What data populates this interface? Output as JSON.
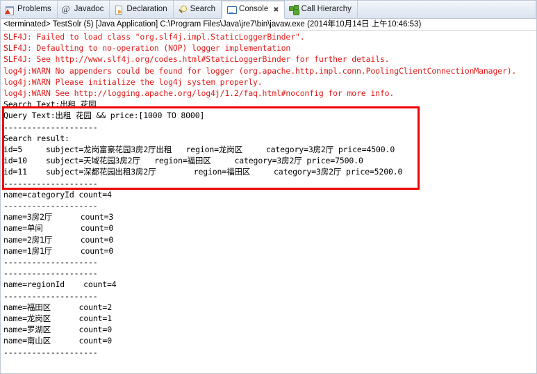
{
  "window": {
    "title": "Console"
  },
  "tabs": [
    {
      "label": "Problems",
      "icon": "problems-icon",
      "active": false,
      "closeable": false
    },
    {
      "label": "Javadoc",
      "icon": "javadoc-icon",
      "active": false,
      "closeable": false
    },
    {
      "label": "Declaration",
      "icon": "declaration-icon",
      "active": false,
      "closeable": false
    },
    {
      "label": "Search",
      "icon": "search-icon",
      "active": false,
      "closeable": false
    },
    {
      "label": "Console",
      "icon": "console-icon",
      "active": true,
      "closeable": true,
      "close_glyph": "✖"
    },
    {
      "label": "Call Hierarchy",
      "icon": "call-hierarchy-icon",
      "active": false,
      "closeable": false
    }
  ],
  "process": {
    "terminated_line": "<terminated> TestSolr (5) [Java Application] C:\\Program Files\\Java\\jre7\\bin\\javaw.exe (2014年10月14日 上午10:46:53)"
  },
  "console": {
    "error_lines": [
      "SLF4J: Failed to load class \"org.slf4j.impl.StaticLoggerBinder\".",
      "SLF4J: Defaulting to no-operation (NOP) logger implementation",
      "SLF4J: See http://www.slf4j.org/codes.html#StaticLoggerBinder for further details.",
      "log4j:WARN No appenders could be found for logger (org.apache.http.impl.conn.PoolingClientConnectionManager).",
      "log4j:WARN Please initialize the log4j system properly.",
      "log4j:WARN See http://logging.apache.org/log4j/1.2/faq.html#noconfig for more info."
    ],
    "output_lines": [
      "Search Text:出租 花园",
      "Query Text:出租 花园 && price:[1000 TO 8000]",
      "--------------------",
      "Search result:",
      "id=5     subject=龙岗富豪花园3房2厅出租   region=龙岗区     category=3房2厅 price=4500.0",
      "id=10    subject=天域花园3房2厅   region=福田区     category=3房2厅 price=7500.0",
      "id=11    subject=深都花园出租3房2厅        region=福田区     category=3房2厅 price=5200.0",
      "--------------------",
      "",
      "name=categoryId count=4",
      "--------------------",
      "name=3房2厅      count=3",
      "name=单间        count=0",
      "name=2房1厅      count=0",
      "name=1房1厅      count=0",
      "",
      "--------------------",
      "--------------------",
      "name=regionId    count=4",
      "--------------------",
      "name=福田区      count=2",
      "name=龙岗区      count=1",
      "name=罗湖区      count=0",
      "name=南山区      count=0",
      "--------------------"
    ]
  },
  "annotation": {
    "highlight_color": "#ee0000",
    "label": "search-result-highlight"
  },
  "colors": {
    "error_text": "#e01b1b",
    "normal_text": "#000000",
    "tab_active_bg": "#ffffff"
  }
}
